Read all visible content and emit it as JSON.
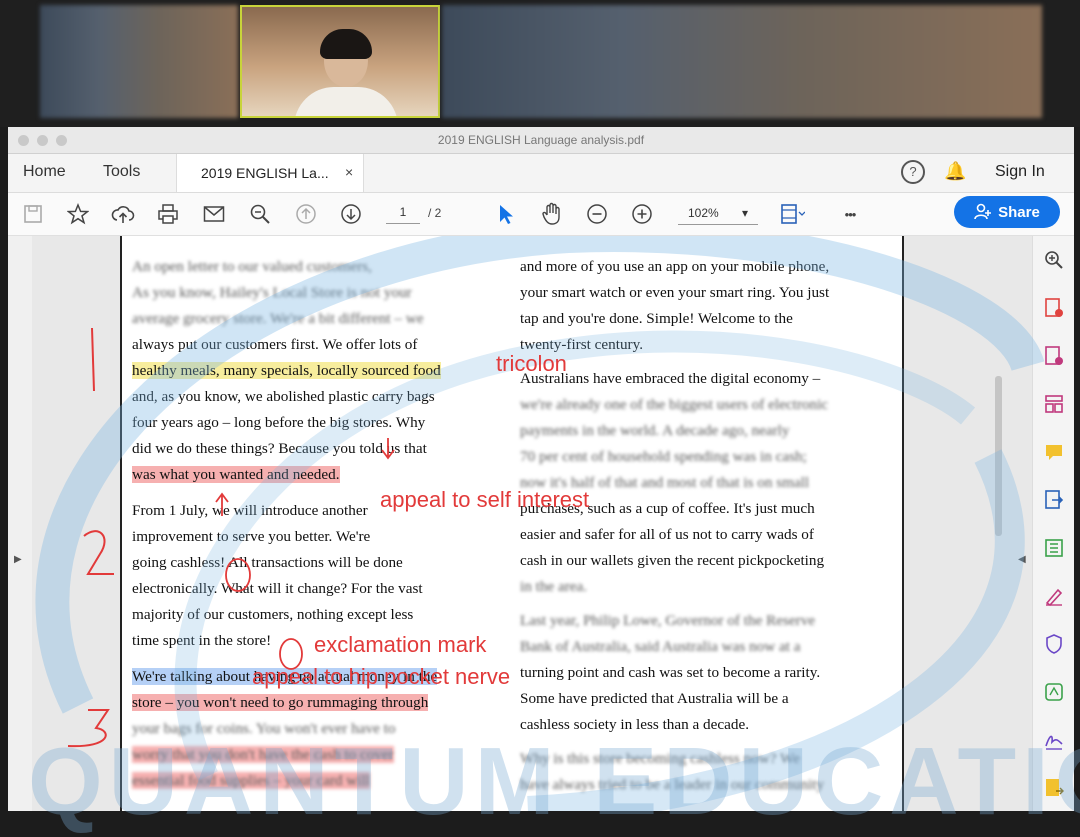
{
  "window": {
    "title": "2019 ENGLISH Language analysis.pdf"
  },
  "menubar": {
    "home": "Home",
    "tools": "Tools",
    "tab_label": "2019 ENGLISH La...",
    "tab_close": "×",
    "help": "?",
    "sign_in": "Sign In"
  },
  "toolbar": {
    "page_current": "1",
    "page_total": "/ 2",
    "zoom": "102%",
    "zoom_arrow": "▾",
    "more": "•••",
    "share": "Share"
  },
  "colors": {
    "accent": "#1473e6",
    "annotation": "#e23a3a",
    "highlight_red": "#ec5050",
    "highlight_yellow": "#f0dc3c",
    "highlight_blue": "#5a96eb",
    "watermark": "#78aad2"
  },
  "document": {
    "left_col": [
      "An open letter to our valued customers,",
      "As you know, Hailey's Local Store is not your",
      "average grocery store. We're a bit different – we",
      "always put our customers first. We offer lots of",
      "healthy meals, many specials, locally sourced food",
      "and, as you know, we abolished plastic carry bags",
      "four years ago – long before the big stores. Why",
      "did we do these things? Because you told us that",
      "was what you wanted and needed.",
      "From 1 July, we will introduce another",
      "improvement to serve you better. We're",
      "going cashless! All transactions will be done",
      "electronically. What will it change? For the vast",
      "majority of our customers, nothing except less",
      "time spent in the store!",
      "We're talking about having no actual money in the",
      "store – you won't need to go rummaging through",
      "your bags for coins. You won't ever have to",
      "worry that you don't have the cash to cover",
      "essential food supplies – your card will"
    ],
    "right_col": [
      "and more of you use an app on your mobile phone,",
      "your smart watch or even your smart ring. You just",
      "tap and you're done. Simple! Welcome to the",
      "twenty-first century.",
      "Australians have embraced the digital economy –",
      "we're already one of the biggest users of electronic",
      "payments in the world. A decade ago, nearly",
      "70 per cent of household spending was in cash;",
      "now it's half of that and most of that is on small",
      "purchases, such as a cup of coffee. It's just much",
      "easier and safer for all of us not to carry wads of",
      "cash in our wallets given the recent pickpocketing",
      "in the area.",
      "Last year, Philip Lowe, Governor of the Reserve",
      "Bank of Australia, said Australia was now at a",
      "turning point and cash was set to become a rarity.",
      "Some have predicted that Australia will be a",
      "cashless society in less than a decade.",
      "Why is this store becoming cashless now? We",
      "have always tried to be a leader in our community"
    ]
  },
  "annotations": {
    "tricolon": "tricolon",
    "self_interest": "appeal to self interest",
    "exclamation": "exclamation mark",
    "hip_pocket": "appeal to hip pocket nerve",
    "num1": "|",
    "num2": "2",
    "num3": "3"
  },
  "watermark": "QUANTUM EDUCATION"
}
